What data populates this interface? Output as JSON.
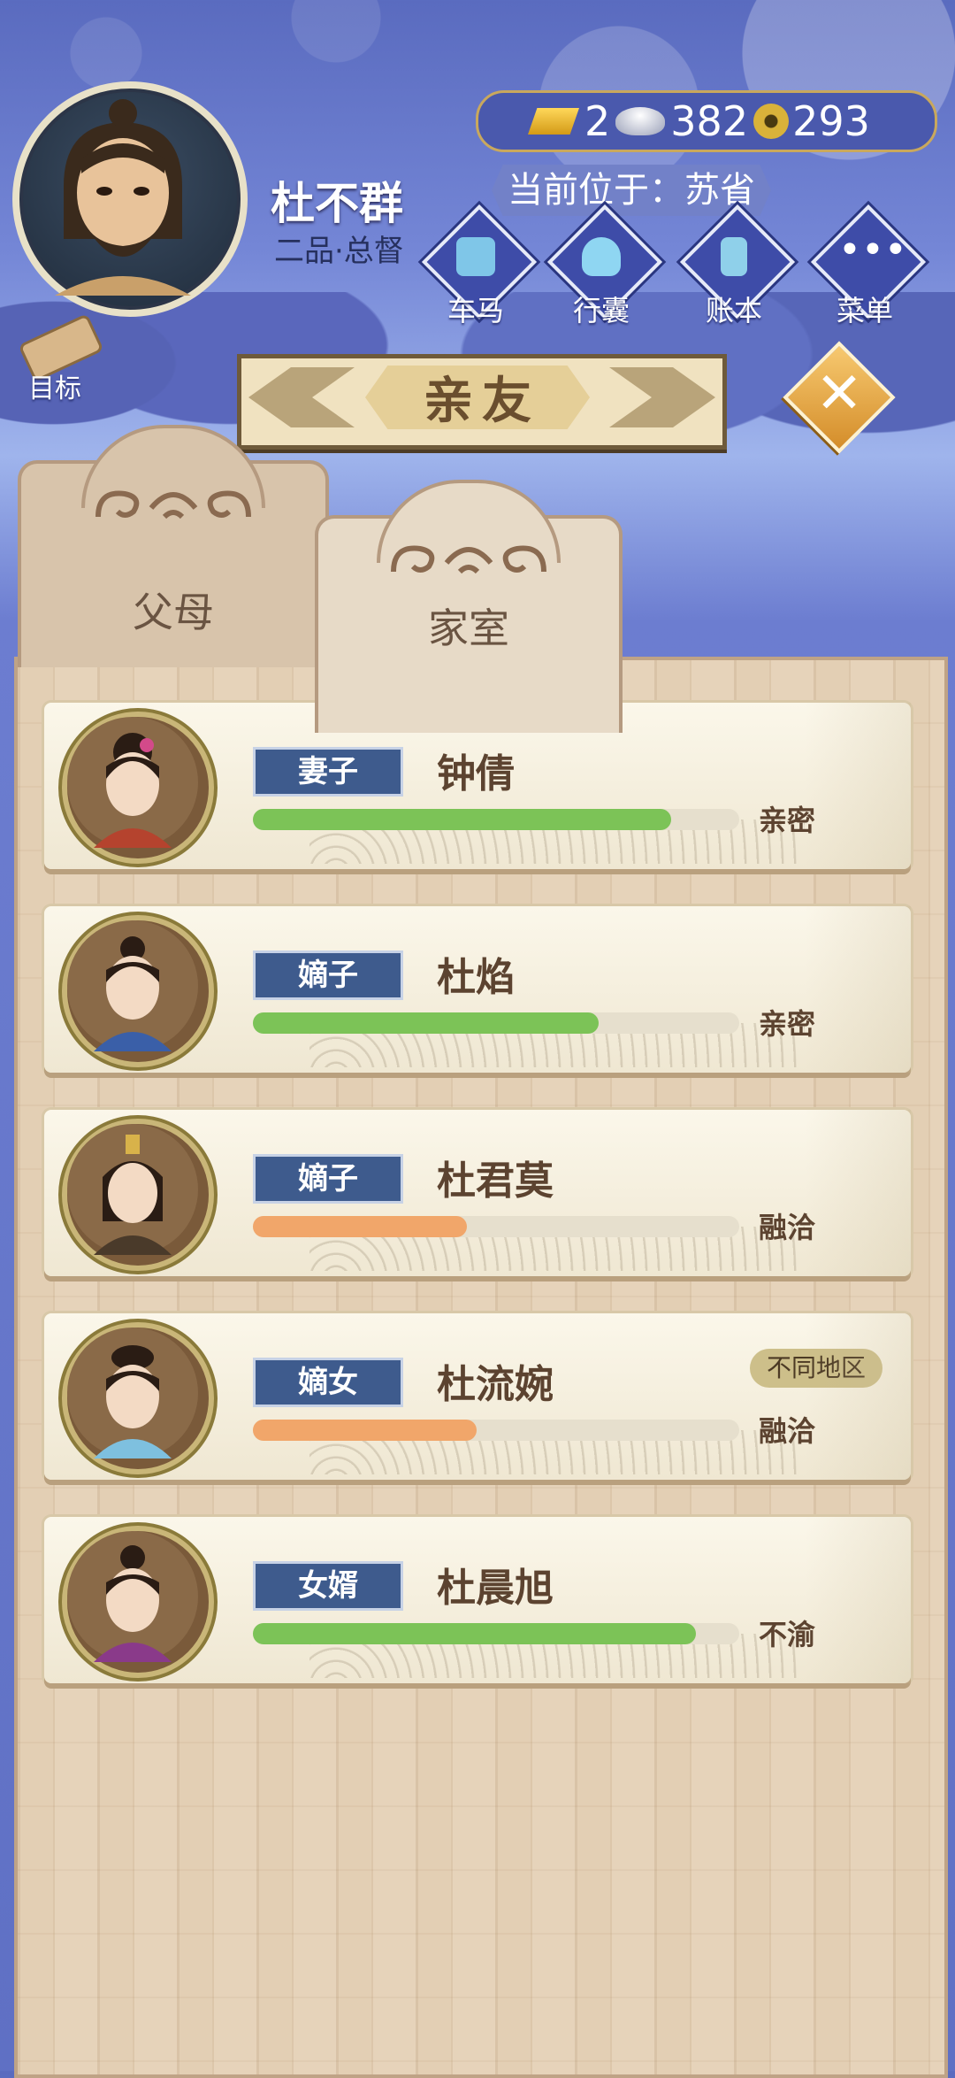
{
  "player": {
    "name": "杜不群",
    "rank": "二品·总督",
    "location": "当前位于：苏省"
  },
  "currency": {
    "gold": "2",
    "silver": "382",
    "copper": "293"
  },
  "nav": {
    "carriage": "车马",
    "bag": "行囊",
    "ledger": "账本",
    "menu": "菜单",
    "goal": "目标"
  },
  "title": "亲友",
  "tabs": {
    "parents": "父母",
    "household": "家室"
  },
  "colors": {
    "bar_green": "#7cc357",
    "bar_orange": "#f1a66a",
    "badge_blue": "#3e5b8d"
  },
  "members": [
    {
      "relation": "妻子",
      "name": "钟倩",
      "status": "亲密",
      "affinity": 0.86,
      "bar": "green",
      "region": ""
    },
    {
      "relation": "嫡子",
      "name": "杜焰",
      "status": "亲密",
      "affinity": 0.71,
      "bar": "green",
      "region": ""
    },
    {
      "relation": "嫡子",
      "name": "杜君莫",
      "status": "融洽",
      "affinity": 0.44,
      "bar": "orange",
      "region": ""
    },
    {
      "relation": "嫡女",
      "name": "杜流婉",
      "status": "融洽",
      "affinity": 0.46,
      "bar": "orange",
      "region": "不同地区"
    },
    {
      "relation": "女婿",
      "name": "杜晨旭",
      "status": "不渝",
      "affinity": 0.91,
      "bar": "green",
      "region": ""
    }
  ]
}
